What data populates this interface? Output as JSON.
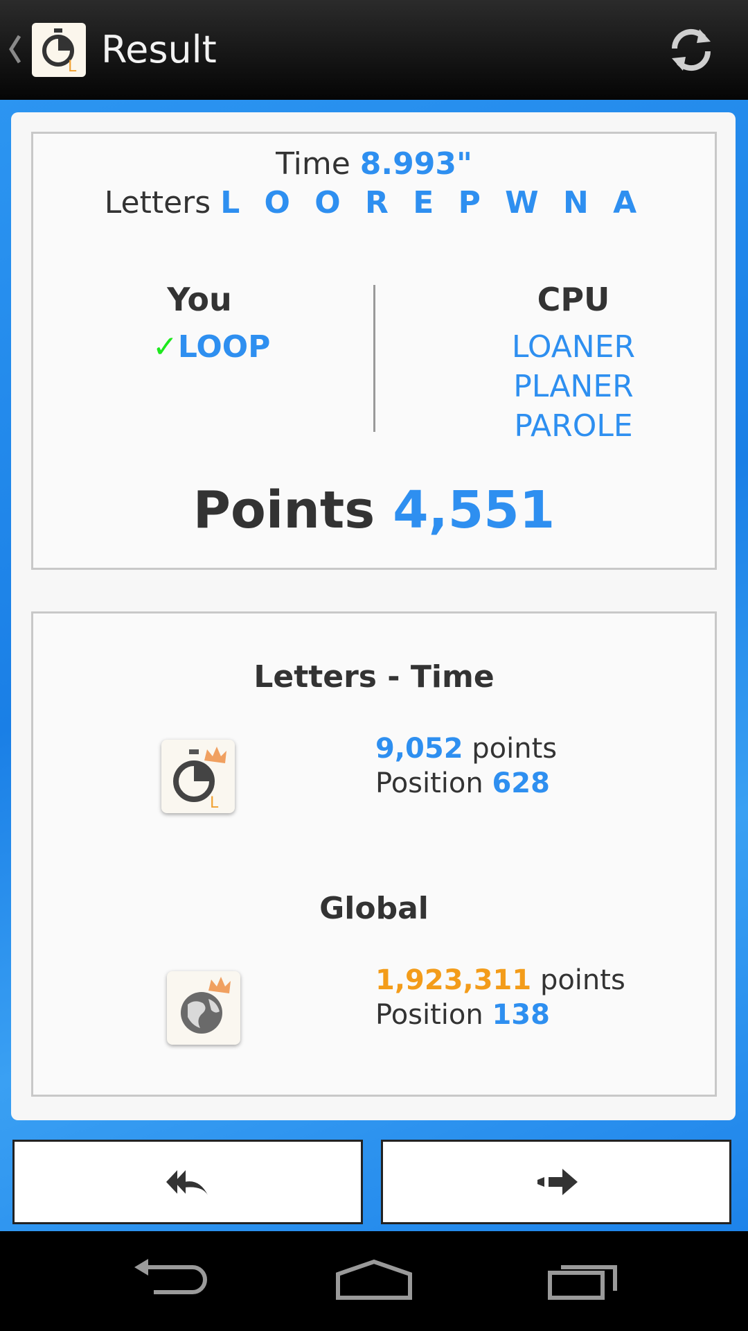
{
  "actionbar": {
    "title": "Result"
  },
  "result": {
    "time_label": "Time",
    "time_value": "8.993\"",
    "letters_label": "Letters",
    "letters_value": "L O O R E P W N A",
    "you_label": "You",
    "you_words": [
      "LOOP"
    ],
    "cpu_label": "CPU",
    "cpu_words": [
      "LOANER",
      "PLANER",
      "PAROLE"
    ],
    "points_label": "Points",
    "points_value": "4,551"
  },
  "ranking": {
    "mode": {
      "title": "Letters - Time",
      "points_value": "9,052",
      "points_label": "points",
      "position_label": "Position",
      "position_value": "628"
    },
    "global": {
      "title": "Global",
      "points_value": "1,923,311",
      "points_label": "points",
      "position_label": "Position",
      "position_value": "138"
    }
  },
  "icons": {
    "app": "stopwatch-letter-icon",
    "refresh": "refresh-icon",
    "back": "double-reply-icon",
    "next": "forward-arrow-icon",
    "mode_rank": "stopwatch-crown-icon",
    "global_rank": "globe-crown-icon"
  },
  "colors": {
    "accent_blue": "#2e8ff0",
    "accent_orange": "#f39c1a",
    "check_green": "#1ee81e",
    "background_blue": "#1a7fe6"
  }
}
